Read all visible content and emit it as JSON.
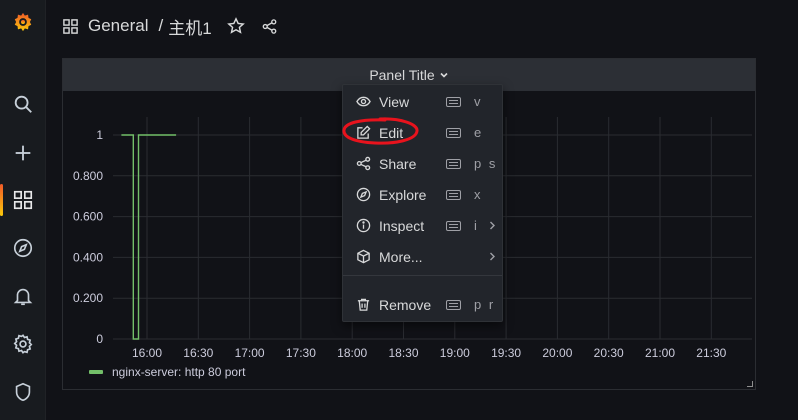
{
  "header": {
    "folder": "General",
    "separator": "/",
    "dashboard_title": "主机1"
  },
  "panel": {
    "title": "Panel Title"
  },
  "menu": {
    "items": [
      {
        "label": "View",
        "icon": "eye-icon",
        "shortcut": "v"
      },
      {
        "label": "Edit",
        "icon": "edit-icon",
        "shortcut": "e"
      },
      {
        "label": "Share",
        "icon": "share-icon",
        "shortcut": "p s"
      },
      {
        "label": "Explore",
        "icon": "compass-icon",
        "shortcut": "x"
      },
      {
        "label": "Inspect",
        "icon": "info-icon",
        "shortcut": "i"
      },
      {
        "label": "More...",
        "icon": "cube-icon",
        "shortcut": ""
      },
      {
        "label": "Remove",
        "icon": "trash-icon",
        "shortcut": "p r"
      }
    ]
  },
  "chart_data": {
    "type": "line",
    "y_ticks": [
      "1",
      "0.800",
      "0.600",
      "0.400",
      "0.200",
      "0"
    ],
    "x_ticks": [
      "16:00",
      "16:30",
      "17:00",
      "17:30",
      "18:00",
      "18:30",
      "19:00",
      "19:30",
      "20:00",
      "20:30",
      "21:00",
      "21:30"
    ],
    "ylim": [
      0,
      1
    ],
    "grid": true,
    "series": [
      {
        "name": "nginx-server: http 80 port",
        "color": "#73bf69",
        "points": [
          [
            "15:45",
            1
          ],
          [
            "15:52",
            1
          ],
          [
            "15:52",
            0
          ],
          [
            "15:55",
            0
          ],
          [
            "15:55",
            1
          ],
          [
            "16:17",
            1
          ]
        ]
      }
    ]
  },
  "colors": {
    "series": "#73bf69",
    "annotation": "#e8131d",
    "accent_gradient": [
      "#f05a28",
      "#fbca0a"
    ]
  }
}
